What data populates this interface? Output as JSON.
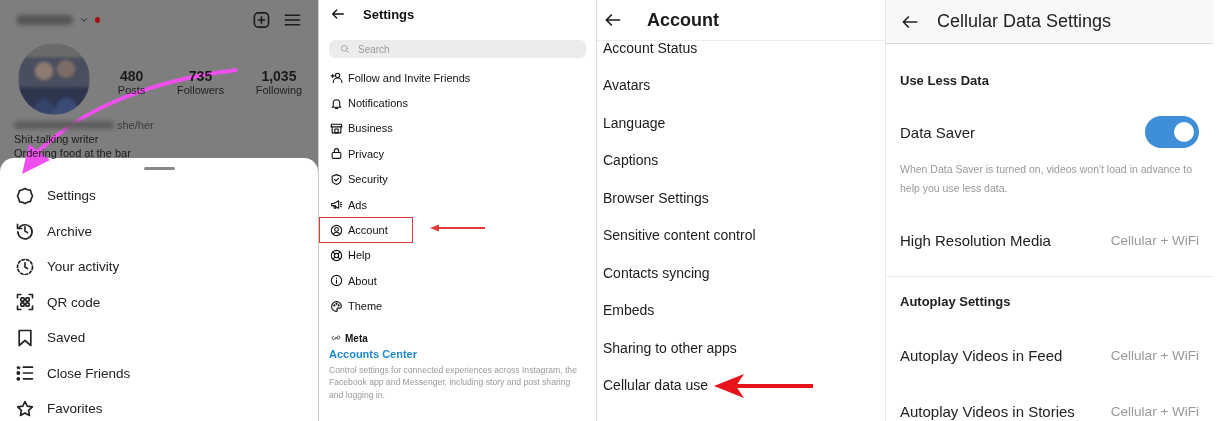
{
  "profile": {
    "stats": [
      {
        "value": "480",
        "label": "Posts"
      },
      {
        "value": "735",
        "label": "Followers"
      },
      {
        "value": "1,035",
        "label": "Following"
      }
    ],
    "pronouns": "she/her",
    "bio": [
      "Shit-talking writer",
      "Ordering food at the bar"
    ],
    "menu": [
      {
        "label": "Settings",
        "annotated": true
      },
      {
        "label": "Archive",
        "annotated": false
      },
      {
        "label": "Your activity",
        "annotated": false
      },
      {
        "label": "QR code",
        "annotated": false
      },
      {
        "label": "Saved",
        "annotated": false
      },
      {
        "label": "Close Friends",
        "annotated": false
      },
      {
        "label": "Favorites",
        "annotated": false
      }
    ]
  },
  "settings": {
    "title": "Settings",
    "search": {
      "placeholder": "Search"
    },
    "items": [
      {
        "label": "Follow and Invite Friends",
        "annotated": false
      },
      {
        "label": "Notifications",
        "annotated": false
      },
      {
        "label": "Business",
        "annotated": false
      },
      {
        "label": "Privacy",
        "annotated": false
      },
      {
        "label": "Security",
        "annotated": false
      },
      {
        "label": "Ads",
        "annotated": false
      },
      {
        "label": "Account",
        "annotated": true
      },
      {
        "label": "Help",
        "annotated": false
      },
      {
        "label": "About",
        "annotated": false
      },
      {
        "label": "Theme",
        "annotated": false
      }
    ],
    "meta": {
      "brand": "Meta",
      "link": "Accounts Center",
      "description": "Control settings for connected experiences across Instagram, the Facebook app and Messenger, including story and post sharing and logging in."
    }
  },
  "account": {
    "title": "Account",
    "items": [
      {
        "label": "Account Status",
        "annotated": false
      },
      {
        "label": "Avatars",
        "annotated": false
      },
      {
        "label": "Language",
        "annotated": false
      },
      {
        "label": "Captions",
        "annotated": false
      },
      {
        "label": "Browser Settings",
        "annotated": false
      },
      {
        "label": "Sensitive content control",
        "annotated": false
      },
      {
        "label": "Contacts syncing",
        "annotated": false
      },
      {
        "label": "Embeds",
        "annotated": false
      },
      {
        "label": "Sharing to other apps",
        "annotated": false
      },
      {
        "label": "Cellular data use",
        "annotated": true
      }
    ]
  },
  "cellular": {
    "title": "Cellular Data Settings",
    "sections": [
      {
        "heading": "Use Less Data",
        "rows": [
          {
            "kind": "toggle",
            "label": "Data Saver",
            "on": true,
            "note": "When Data Saver is turned on, videos won't load in advance to help you use less data."
          },
          {
            "kind": "value",
            "label": "High Resolution Media",
            "value": "Cellular + WiFi"
          }
        ]
      },
      {
        "heading": "Autoplay Settings",
        "rows": [
          {
            "kind": "value",
            "label": "Autoplay Videos in Feed",
            "value": "Cellular + WiFi"
          },
          {
            "kind": "value",
            "label": "Autoplay Videos in Stories",
            "value": "Cellular + WiFi"
          }
        ]
      }
    ]
  }
}
